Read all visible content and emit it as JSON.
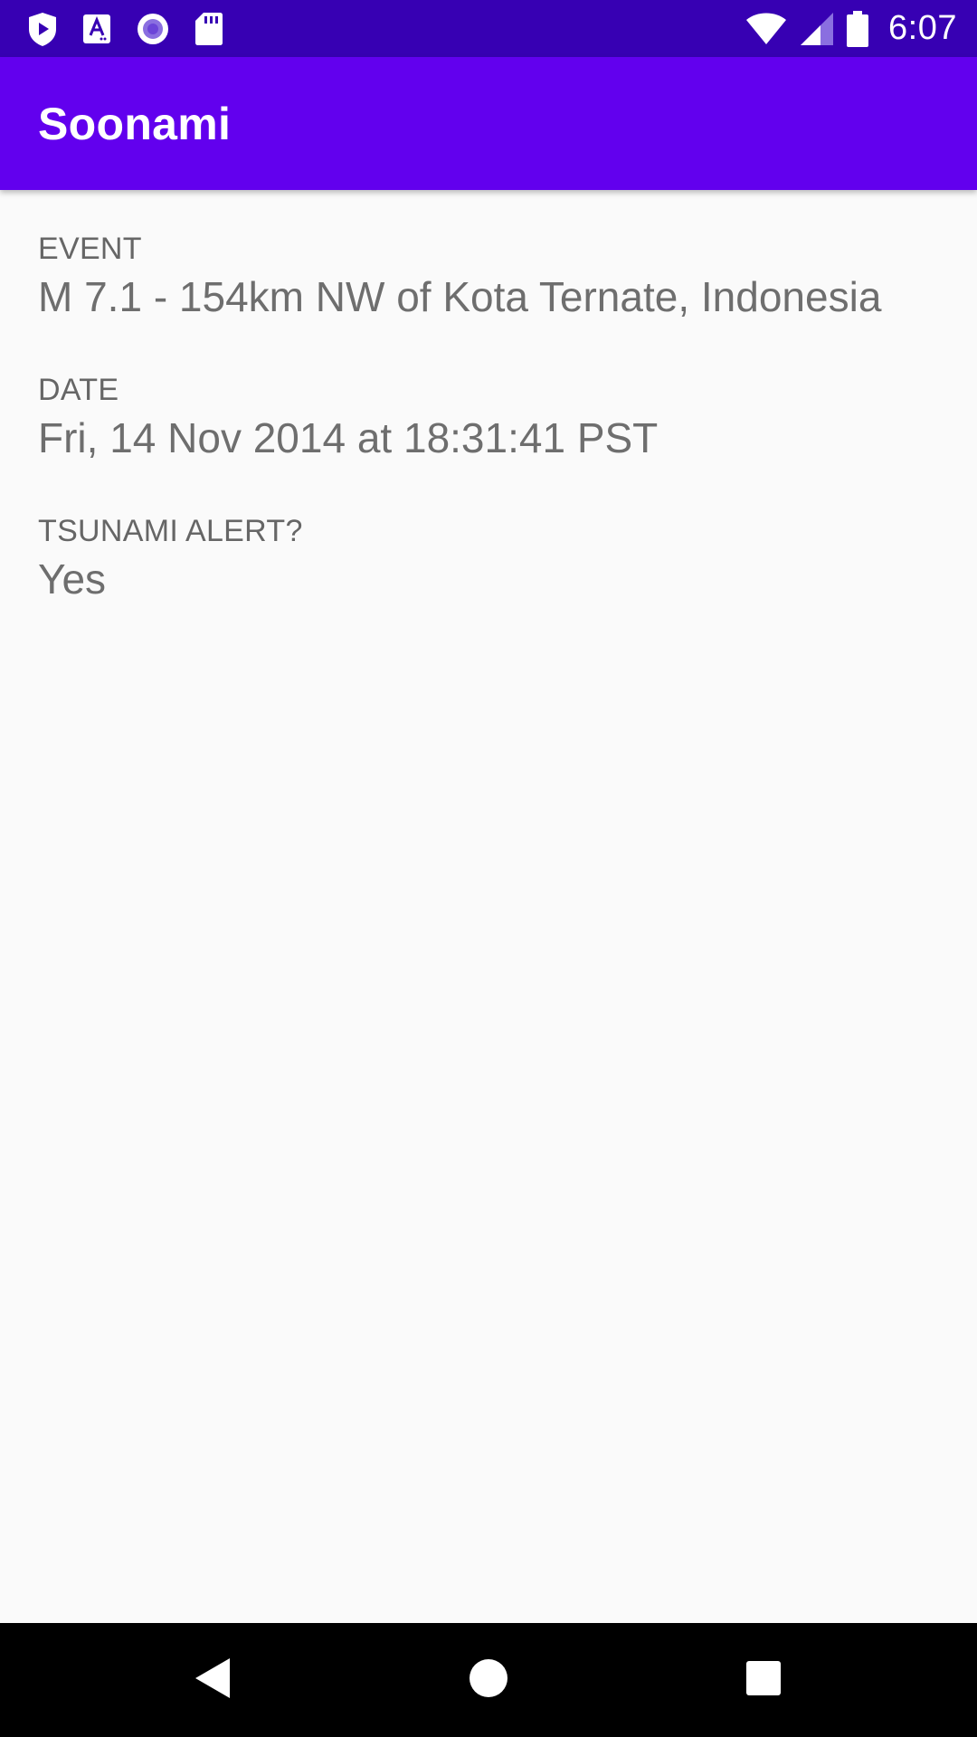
{
  "status_bar": {
    "time": "6:07",
    "left_icons": [
      "shield-play-icon",
      "text-a-icon",
      "record-circle-icon",
      "sd-card-icon"
    ],
    "right_icons": [
      "wifi-icon",
      "cell-signal-icon",
      "battery-icon"
    ],
    "color": "#3700b3"
  },
  "app_bar": {
    "title": "Soonami",
    "color": "#6200ee"
  },
  "details": {
    "event": {
      "label": "EVENT",
      "value": "M 7.1 - 154km NW of Kota Ternate, Indonesia"
    },
    "date": {
      "label": "DATE",
      "value": "Fri, 14 Nov 2014 at 18:31:41 PST"
    },
    "tsunami": {
      "label": "TSUNAMI ALERT?",
      "value": "Yes"
    }
  },
  "nav_bar": {
    "buttons": [
      "back-icon",
      "home-icon",
      "recents-icon"
    ]
  }
}
